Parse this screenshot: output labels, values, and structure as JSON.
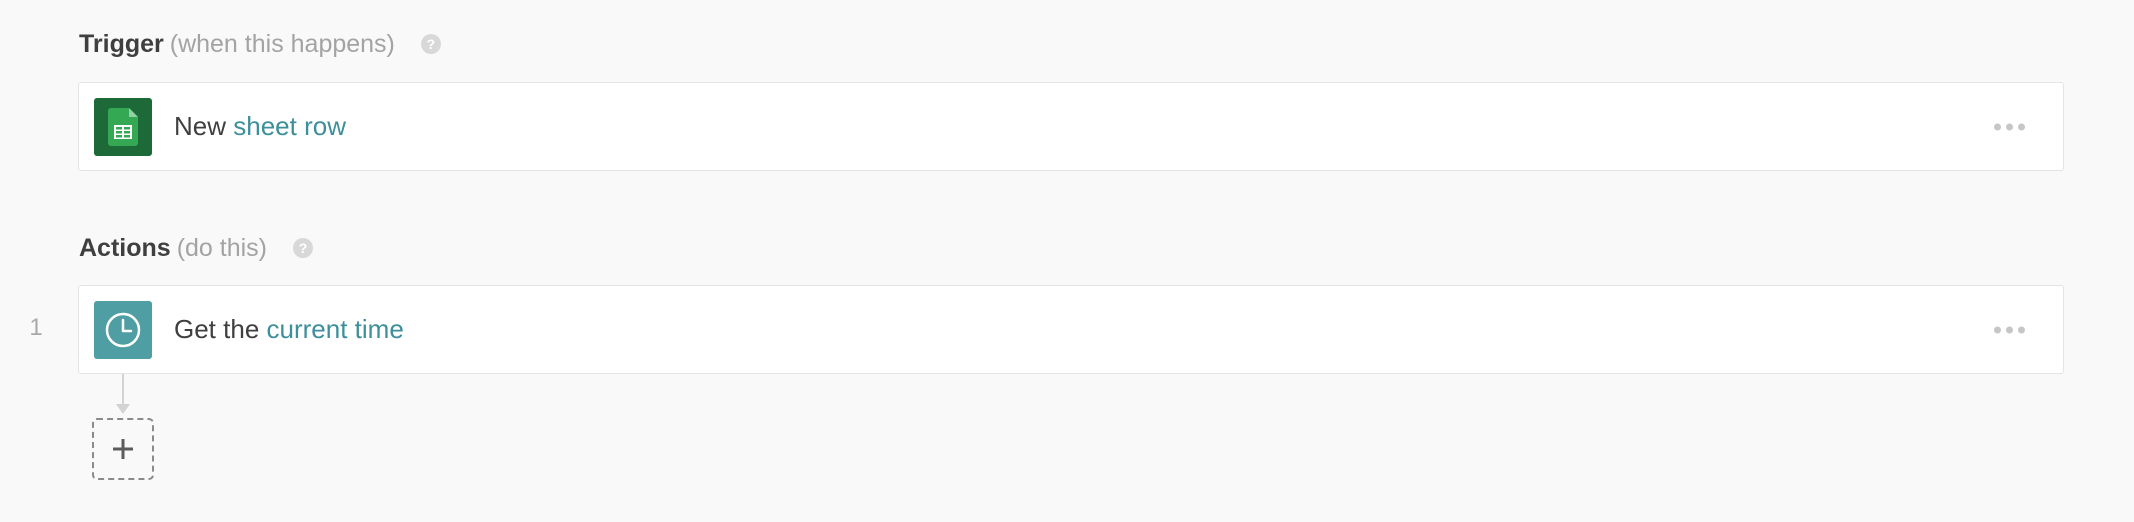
{
  "trigger": {
    "title": "Trigger",
    "subtitle": "(when this happens)",
    "help": "?",
    "card": {
      "icon": "google-sheets-icon",
      "prefix": "New",
      "link": "sheet row"
    }
  },
  "actions": {
    "title": "Actions",
    "subtitle": "(do this)",
    "help": "?",
    "steps": [
      {
        "number": "1",
        "icon": "clock-icon",
        "prefix": "Get the",
        "link": "current time"
      }
    ]
  },
  "colors": {
    "background": "#f9f9f9",
    "link": "#3c8f9b",
    "sheets_green": "#1d6a38",
    "clock_teal": "#4f9ea4"
  }
}
